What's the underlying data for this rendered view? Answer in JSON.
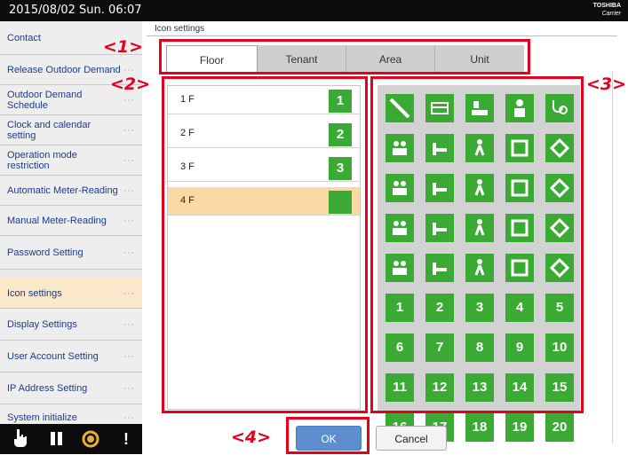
{
  "header": {
    "datetime": "2015/08/02 Sun. 06:07",
    "brand_line1": "TOSHIBA",
    "brand_line2": "Carrier"
  },
  "sidebar": {
    "items": [
      {
        "label": "Contact",
        "dots": ""
      },
      {
        "label": "Release Outdoor Demand",
        "dots": "···"
      },
      {
        "label": "Outdoor Demand Schedule",
        "dots": "···"
      },
      {
        "label": "Clock and calendar setting",
        "dots": "···"
      },
      {
        "label": "Operation mode restriction",
        "dots": "···"
      },
      {
        "label": "Automatic Meter-Reading",
        "dots": "···"
      },
      {
        "label": "Manual Meter-Reading",
        "dots": "···"
      },
      {
        "label": "Password Setting",
        "dots": "···"
      },
      {
        "label": "Icon settings",
        "dots": "···",
        "active": true
      },
      {
        "label": "Display Settings",
        "dots": "···"
      },
      {
        "label": "User Account Setting",
        "dots": "···"
      },
      {
        "label": "IP Address Setting",
        "dots": "···"
      },
      {
        "label": "System initialize",
        "dots": "···"
      }
    ]
  },
  "bottom_bar": {
    "icons": [
      "hand-pointer-icon",
      "pause-icon",
      "sun-icon",
      "alert-icon"
    ],
    "alert_glyph": "!"
  },
  "main": {
    "section_title": "Icon settings",
    "tabs": [
      {
        "label": "Floor",
        "active": true
      },
      {
        "label": "Tenant",
        "active": false
      },
      {
        "label": "Area",
        "active": false
      },
      {
        "label": "Unit",
        "active": false
      }
    ],
    "floors": [
      {
        "label": "1 F",
        "icon": "1",
        "selected": false
      },
      {
        "label": "2 F",
        "icon": "2",
        "selected": false
      },
      {
        "label": "3 F",
        "icon": "3",
        "selected": false
      },
      {
        "label": "4 F",
        "icon": "",
        "selected": true
      }
    ],
    "icon_palette": {
      "pictogram_icons": [
        "slash-icon",
        "bus-icon",
        "office-desk-icon",
        "person-icon",
        "stethoscope-icon",
        "group-icon",
        "hospital-bed-icon",
        "walking-person-icon",
        "teacher-icon",
        "shopping-icon",
        "cooking-icon",
        "microscope-icon",
        "counter-icon",
        "dining-icon",
        "gift-icon",
        "family-icon",
        "parent-child-icon",
        "reception-icon",
        "door-icon",
        "box-icon",
        "window-frame-icon",
        "diamond-arrows-icon",
        "layers-icon",
        "horizontal-arrows-icon",
        "outline-diamond-icon"
      ],
      "numbers": [
        "1",
        "2",
        "3",
        "4",
        "5",
        "6",
        "7",
        "8",
        "9",
        "10",
        "11",
        "12",
        "13",
        "14",
        "15",
        "16",
        "17",
        "18",
        "19",
        "20"
      ]
    },
    "buttons": {
      "ok_label": "OK",
      "cancel_label": "Cancel"
    }
  },
  "annotations": [
    "<1>",
    "<2>",
    "<3>",
    "<4>"
  ],
  "colors": {
    "accent_green": "#3aaa35",
    "selected_orange": "#fbd9a4",
    "annotation_red": "#e6001f",
    "ok_blue": "#5d8ed0"
  }
}
